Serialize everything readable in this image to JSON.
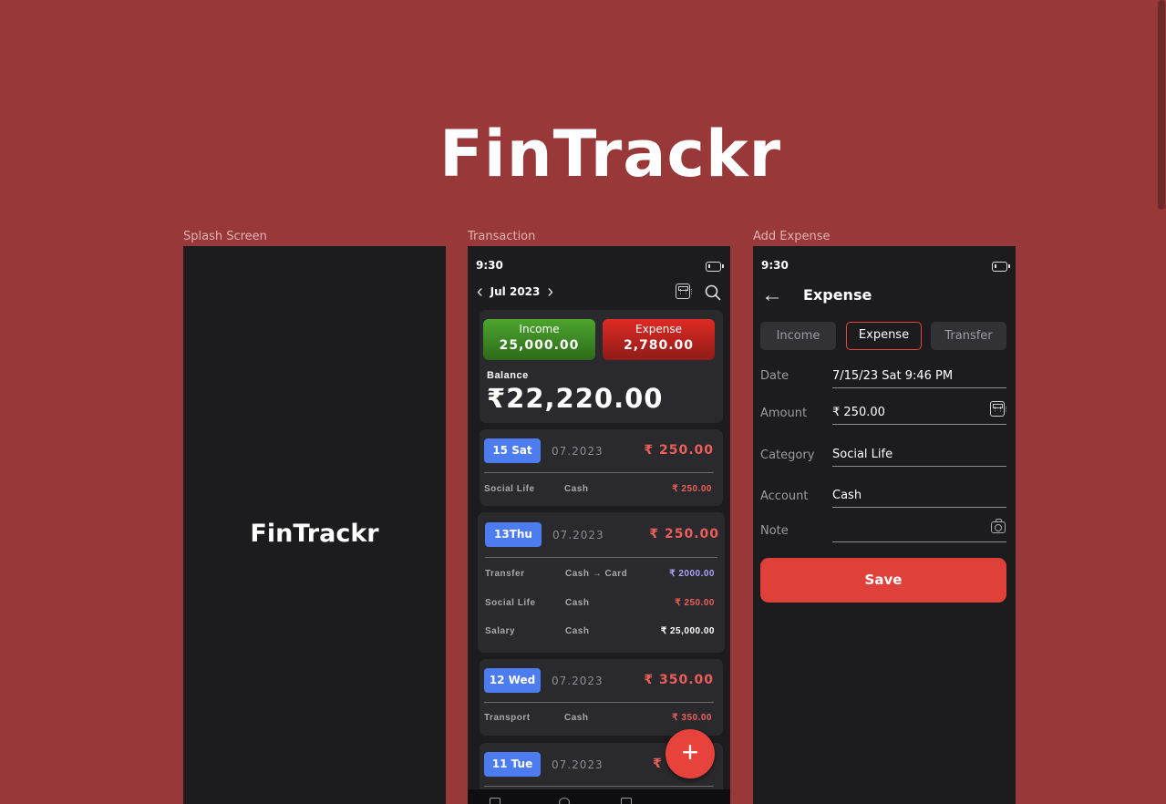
{
  "app_title": "FinTrackr",
  "frames": {
    "splash_label": "Splash Screen",
    "transaction_label": "Transaction",
    "add_expense_label": "Add Expense"
  },
  "splash": {
    "logo": "FinTrackr"
  },
  "transaction": {
    "status_time": "9:30",
    "month": "Jul 2023",
    "income_label": "Income",
    "income_value": "25,000.00",
    "expense_label": "Expense",
    "expense_value": "2,780.00",
    "balance_label": "Balance",
    "balance_value": "₹22,220.00",
    "days": [
      {
        "badge": "15 Sat",
        "date": "07.2023",
        "total": "₹ 250.00",
        "rows": [
          {
            "category": "Social Life",
            "account": "Cash",
            "amount": "₹ 250.00"
          }
        ]
      },
      {
        "badge": "13Thu",
        "date": "07.2023",
        "total": "₹ 250.00",
        "rows": [
          {
            "category": "Transfer",
            "account": "Cash → Card",
            "amount": "₹ 2000.00"
          },
          {
            "category": "Social Life",
            "account": "Cash",
            "amount": "₹ 250.00"
          },
          {
            "category": "Salary",
            "account": "Cash",
            "amount": "₹ 25,000.00"
          }
        ]
      },
      {
        "badge": "12 Wed",
        "date": "07.2023",
        "total": "₹ 350.00",
        "rows": [
          {
            "category": "Transport",
            "account": "Cash",
            "amount": "₹ 350.00"
          }
        ]
      },
      {
        "badge": "11 Tue",
        "date": "07.2023",
        "total": "₹ 5"
      }
    ],
    "fab_symbol": "+"
  },
  "add_expense": {
    "status_time": "9:30",
    "heading": "Expense",
    "tabs": [
      "Income",
      "Expense",
      "Transfer"
    ],
    "active_tab": "Expense",
    "fields": {
      "date_label": "Date",
      "date_value": "7/15/23  Sat  9:46 PM",
      "amount_label": "Amount",
      "amount_value": "₹ 250.00",
      "category_label": "Category",
      "category_value": "Social Life",
      "account_label": "Account",
      "account_value": "Cash",
      "note_label": "Note",
      "note_value": ""
    },
    "save_label": "Save"
  },
  "colors": {
    "background": "#993838",
    "phone_bg": "#1c1b1d",
    "card_bg": "#2a292d",
    "income_green": "#4ca52e",
    "expense_red": "#e02a24",
    "accent_red": "#e7423b",
    "badge_blue": "#4d7cf0",
    "transfer_purple": "#a9a4f7"
  },
  "icons": [
    "battery-icon",
    "chevron-left-icon",
    "chevron-right-icon",
    "calculator-icon",
    "search-icon",
    "back-arrow-icon",
    "camera-icon",
    "plus-icon"
  ]
}
